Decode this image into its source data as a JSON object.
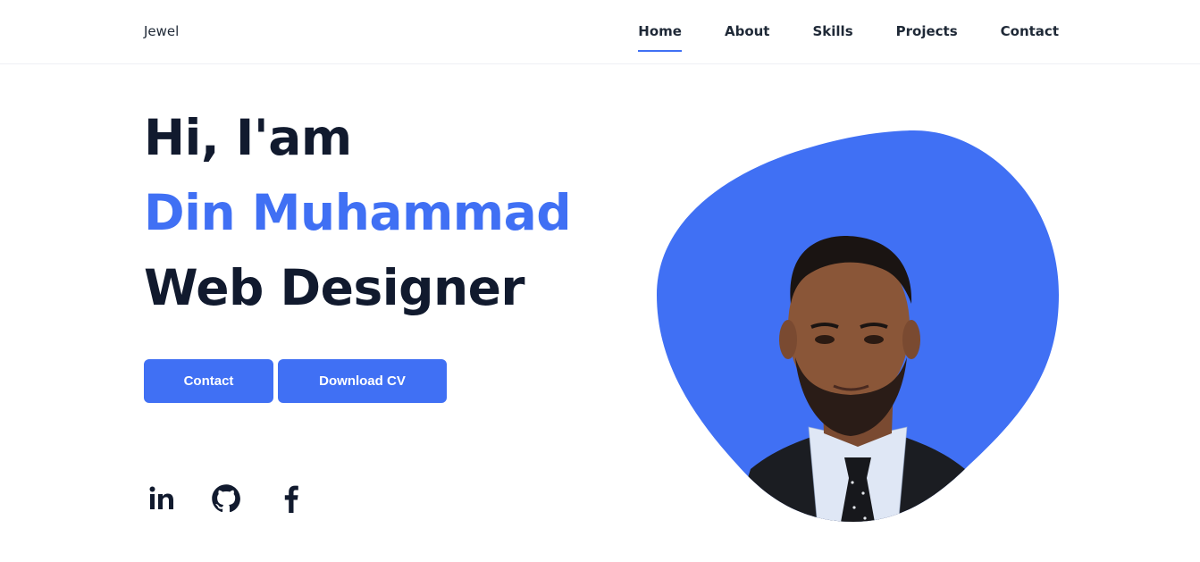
{
  "header": {
    "logo": "Jewel",
    "nav": [
      {
        "label": "Home",
        "active": true
      },
      {
        "label": "About",
        "active": false
      },
      {
        "label": "Skills",
        "active": false
      },
      {
        "label": "Projects",
        "active": false
      },
      {
        "label": "Contact",
        "active": false
      }
    ]
  },
  "hero": {
    "greeting": "Hi, I'am",
    "name": "Din Muhammad",
    "role": "Web Designer",
    "buttons": {
      "contact": "Contact",
      "download_cv": "Download CV"
    }
  },
  "social": [
    {
      "icon": "linkedin-icon"
    },
    {
      "icon": "github-icon"
    },
    {
      "icon": "facebook-icon"
    }
  ],
  "colors": {
    "accent": "#4070f4",
    "heading": "#111a2e",
    "background": "#ffffff"
  }
}
